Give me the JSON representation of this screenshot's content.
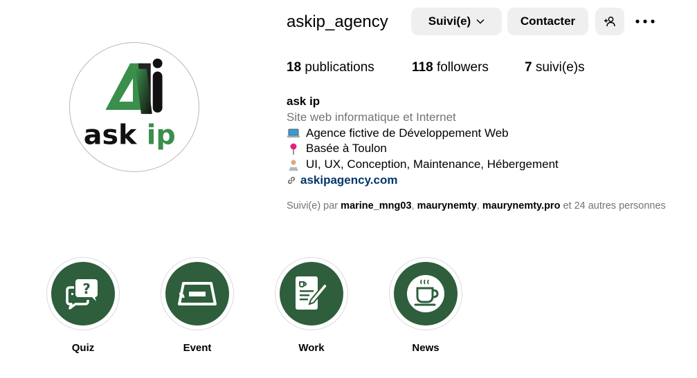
{
  "profile": {
    "username": "askip_agency",
    "avatar_text": "ask ip",
    "avatar_monogram": "Ai"
  },
  "actions": {
    "follow_label": "Suivi(e)",
    "contact_label": "Contacter",
    "suggest_icon": "add-person-icon",
    "more_icon": "more-horizontal-icon"
  },
  "stats": {
    "posts_count": "18",
    "posts_label": "publications",
    "followers_count": "118",
    "followers_label": "followers",
    "following_count": "7",
    "following_label": "suivi(e)s"
  },
  "bio": {
    "name": "ask ip",
    "category": "Site web informatique et Internet",
    "lines": [
      {
        "icon": "laptop-emoji",
        "text": "Agence fictive de Développement Web"
      },
      {
        "icon": "round-pushpin-emoji",
        "text": "Basée à Toulon"
      },
      {
        "icon": "technologist-emoji",
        "text": "UI, UX, Conception, Maintenance, Hébergement"
      }
    ],
    "link": "askipagency.com"
  },
  "followed_by": {
    "prefix": "Suivi(e) par",
    "users": [
      "marine_mng03",
      "maurynemty",
      "maurynemty.pro"
    ],
    "sep": ",",
    "suffix": "et 24 autres personnes"
  },
  "highlights": [
    {
      "label": "Quiz",
      "icon": "question-chat-icon"
    },
    {
      "label": "Event",
      "icon": "ticket-icon"
    },
    {
      "label": "Work",
      "icon": "document-edit-icon"
    },
    {
      "label": "News",
      "icon": "coffee-cup-icon"
    }
  ],
  "colors": {
    "brand_green": "#3a8f4b",
    "highlight_bg": "#2e5e3c",
    "button_bg": "#efefef",
    "link": "#00376b",
    "muted": "#737373"
  }
}
